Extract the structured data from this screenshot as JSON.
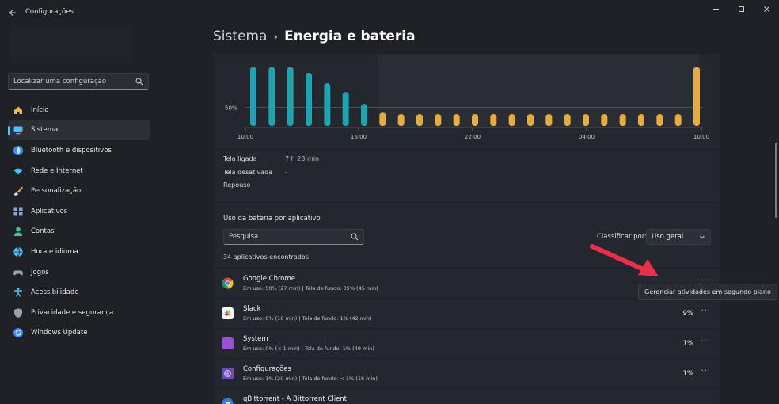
{
  "window": {
    "title": "Configurações",
    "back_icon": "back-arrow-icon",
    "controls": [
      "minimize-icon",
      "maximize-icon",
      "close-icon"
    ]
  },
  "sidebar": {
    "search_placeholder": "Localizar uma configuração",
    "items": [
      {
        "label": "Início",
        "icon": "home-icon",
        "color": "#f2b451"
      },
      {
        "label": "Sistema",
        "icon": "monitor-icon",
        "color": "#4cc2ff",
        "active": true
      },
      {
        "label": "Bluetooth e dispositivos",
        "icon": "bluetooth-icon",
        "color": "#3d8bff"
      },
      {
        "label": "Rede e Internet",
        "icon": "wifi-icon",
        "color": "#4cc2ff"
      },
      {
        "label": "Personalização",
        "icon": "brush-icon",
        "color": "#f0a64a"
      },
      {
        "label": "Aplicativos",
        "icon": "apps-icon",
        "color": "#8aa6d8"
      },
      {
        "label": "Contas",
        "icon": "person-icon",
        "color": "#3fc58e"
      },
      {
        "label": "Hora e idioma",
        "icon": "globe-icon",
        "color": "#4cc2ff"
      },
      {
        "label": "Jogos",
        "icon": "gamepad-icon",
        "color": "#9aa2ae"
      },
      {
        "label": "Acessibilidade",
        "icon": "accessibility-icon",
        "color": "#4cc2ff"
      },
      {
        "label": "Privacidade e segurança",
        "icon": "shield-icon",
        "color": "#9aa2ae"
      },
      {
        "label": "Windows Update",
        "icon": "update-icon",
        "color": "#3d8bff"
      }
    ]
  },
  "breadcrumb": {
    "root": "Sistema",
    "separator": "›",
    "page": "Energia e bateria"
  },
  "chart_data": {
    "type": "bar",
    "gridline_label": "50%",
    "x_tick_labels": [
      "10:00",
      "16:00",
      "22:00",
      "04:00",
      "10:00"
    ],
    "colors": {
      "charging": "#1fa3b0",
      "discharging": "#e3ad3f"
    },
    "bars": [
      {
        "value": 80,
        "state": "charging"
      },
      {
        "value": 80,
        "state": "charging"
      },
      {
        "value": 80,
        "state": "charging"
      },
      {
        "value": 72,
        "state": "charging"
      },
      {
        "value": 58,
        "state": "charging"
      },
      {
        "value": 46,
        "state": "charging"
      },
      {
        "value": 30,
        "state": "charging"
      },
      {
        "value": 18,
        "state": "discharging"
      },
      {
        "value": 16,
        "state": "discharging"
      },
      {
        "value": 16,
        "state": "discharging"
      },
      {
        "value": 16,
        "state": "discharging"
      },
      {
        "value": 16,
        "state": "discharging"
      },
      {
        "value": 16,
        "state": "discharging"
      },
      {
        "value": 16,
        "state": "discharging"
      },
      {
        "value": 16,
        "state": "discharging"
      },
      {
        "value": 16,
        "state": "discharging"
      },
      {
        "value": 16,
        "state": "discharging"
      },
      {
        "value": 16,
        "state": "discharging"
      },
      {
        "value": 16,
        "state": "discharging"
      },
      {
        "value": 16,
        "state": "discharging"
      },
      {
        "value": 16,
        "state": "discharging"
      },
      {
        "value": 16,
        "state": "discharging"
      },
      {
        "value": 16,
        "state": "discharging"
      },
      {
        "value": 16,
        "state": "discharging"
      },
      {
        "value": 80,
        "state": "discharging"
      }
    ]
  },
  "screen_stats": [
    {
      "label": "Tela ligada",
      "value": "7 h 23 min"
    },
    {
      "label": "Tela desativada",
      "value": "-"
    },
    {
      "label": "Repouso",
      "value": "-"
    }
  ],
  "apps_section": {
    "title": "Uso da bateria por aplicativo",
    "search_placeholder": "Pesquisa",
    "sort_label": "Classificar por:",
    "sort_value": "Uso geral",
    "found": "34 aplicativos encontrados",
    "more_glyph": "···",
    "apps": [
      {
        "name": "Google Chrome",
        "detail": "Em uso: 50% (27 min) | Tela de fundo: 35% (45 min)",
        "pct": "",
        "icon": "chrome-icon",
        "more_dim": false
      },
      {
        "name": "Slack",
        "detail": "Em uso: 8% (16 min) | Tela de fundo: 1% (42 min)",
        "pct": "9%",
        "icon": "slack-icon",
        "more_dim": false
      },
      {
        "name": "System",
        "detail": "Em uso: 0% (< 1 min) | Tela de fundo: 1% (49 min)",
        "pct": "1%",
        "icon": "system-icon",
        "more_dim": true
      },
      {
        "name": "Configurações",
        "detail": "Em uso: 1% (20 min) | Tela de fundo: < 1% (16 min)",
        "pct": "1%",
        "icon": "settings-icon",
        "more_dim": false
      },
      {
        "name": "qBittorrent - A Bittorrent Client",
        "detail": "",
        "pct": "",
        "icon": "qbittorrent-icon",
        "more_dim": false
      }
    ]
  },
  "tooltip": "Gerenciar atividades em segundo plano",
  "annotation_color": "#e8304a"
}
